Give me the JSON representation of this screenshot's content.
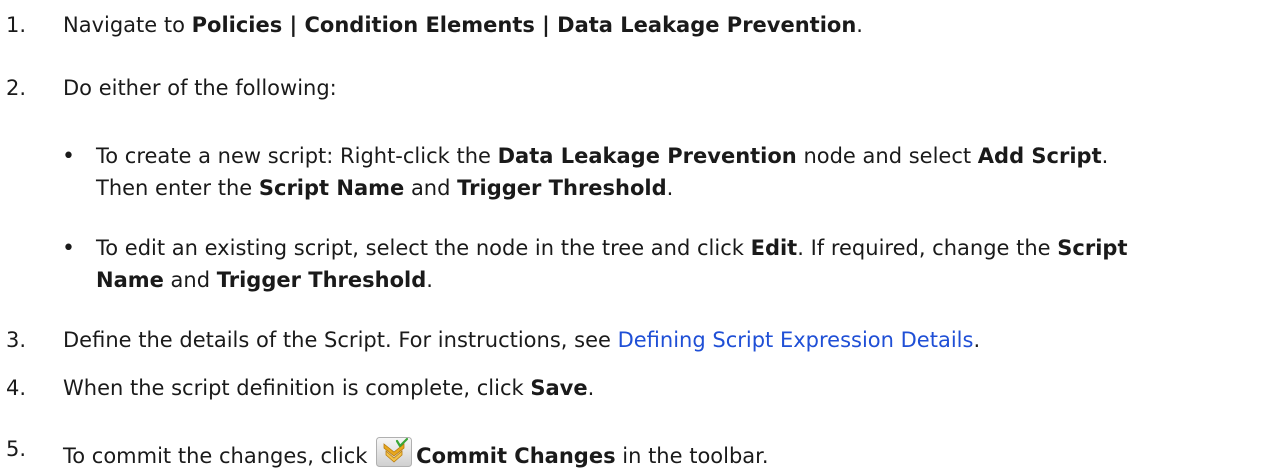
{
  "steps": {
    "s1": {
      "num": "1.",
      "pre": "Navigate to ",
      "bold": "Policies | Condition Elements | Data Leakage Prevention",
      "post": "."
    },
    "s2": {
      "num": "2.",
      "text": "Do either of the following:"
    },
    "b1": {
      "a": "To create a new script: Right-click the ",
      "b": "Data Leakage Prevention",
      "c": " node and select ",
      "d": "Add Script",
      "e": ".",
      "f": "Then enter the ",
      "g": "Script Name",
      "h": " and ",
      "i": "Trigger Threshold",
      "j": "."
    },
    "b2": {
      "a": "To edit an existing script, select the node in the tree and click ",
      "b": "Edit",
      "c": ". If required, change the ",
      "d": "Script",
      "e": "Name",
      "f": " and ",
      "g": "Trigger Threshold",
      "h": "."
    },
    "s3": {
      "num": "3.",
      "pre": "Define the details of the Script. For instructions, see ",
      "link": "Defining Script Expression Details",
      "post": "."
    },
    "s4": {
      "num": "4.",
      "pre": "When the script definition is complete, click ",
      "bold": "Save",
      "post": "."
    },
    "s5": {
      "num": "5.",
      "pre": "To commit the changes, click ",
      "icon": "commit-changes-icon",
      "bold": "Commit Changes",
      "post": " in the toolbar."
    }
  },
  "bullet_char": "•",
  "colors": {
    "text": "#1a1a1a",
    "link": "#1f4fd6"
  }
}
